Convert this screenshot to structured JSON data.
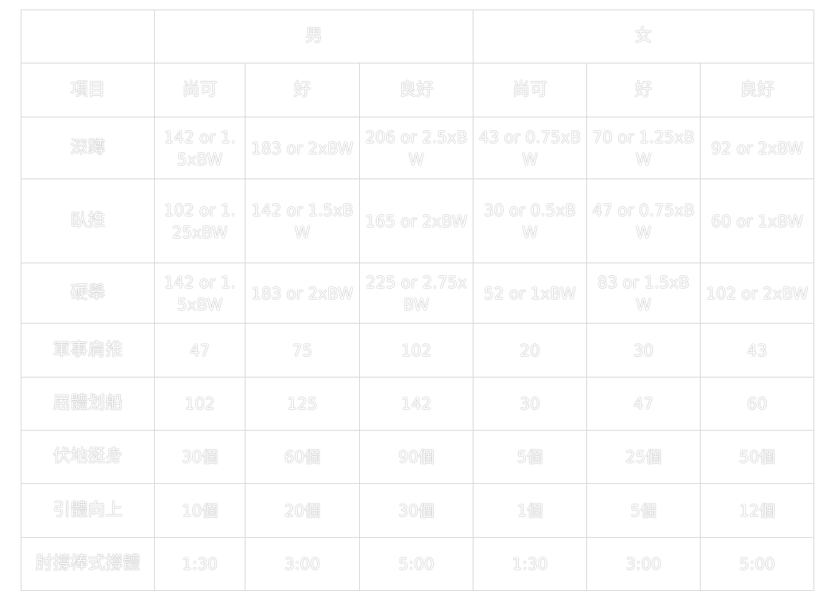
{
  "corner": "",
  "groups": [
    "男",
    "女"
  ],
  "header": {
    "label": "項目",
    "levels": [
      "尚可",
      "好",
      "良好",
      "尚可",
      "好",
      "良好"
    ]
  },
  "rows": [
    {
      "label": "深蹲",
      "cells": [
        "142 or 1.5xBW",
        "183 or 2xBW",
        "206 or 2.5xBW",
        "43 or 0.75xBW",
        "70 or 1.25xBW",
        "92 or 2xBW"
      ]
    },
    {
      "label": "臥推",
      "cells": [
        "102 or 1.25xBW",
        "142 or 1.5xBW",
        "165 or 2xBW",
        "30 or 0.5xBW",
        "47 or 0.75xBW",
        "60 or 1xBW"
      ]
    },
    {
      "label": "硬舉",
      "cells": [
        "142 or 1.5xBW",
        "183 or 2xBW",
        "225 or 2.75xBW",
        "52 or 1xBW",
        "83 or 1.5xBW",
        "102 or 2xBW"
      ]
    },
    {
      "label": "軍事肩推",
      "cells": [
        "47",
        "75",
        "102",
        "20",
        "30",
        "43"
      ]
    },
    {
      "label": "屈體划船",
      "cells": [
        "102",
        "125",
        "142",
        "30",
        "47",
        "60"
      ]
    },
    {
      "label": "伏地挺身",
      "cells": [
        "30個",
        "60個",
        "90個",
        "5個",
        "25個",
        "50個"
      ]
    },
    {
      "label": "引體向上",
      "cells": [
        "10個",
        "20個",
        "30個",
        "1個",
        "5個",
        "12個"
      ]
    },
    {
      "label": "肘撐棒式撐體",
      "cells": [
        "1:30",
        "3:00",
        "5:00",
        "1:30",
        "3:00",
        "5:00"
      ]
    }
  ]
}
